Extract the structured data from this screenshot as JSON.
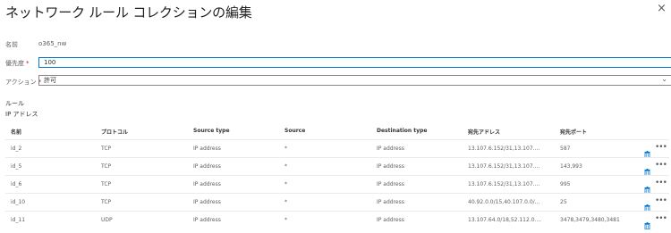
{
  "panel": {
    "title": "ネットワーク ルール コレクションの編集",
    "close": "×"
  },
  "form": {
    "name_label": "名前",
    "name_value": "o365_nw",
    "priority_label": "優先度",
    "priority_value": "100",
    "action_label": "アクション",
    "action_value": "許可",
    "required_mark": "*"
  },
  "rules": {
    "section_label": "ルール",
    "subsection_label": "IP アドレス",
    "columns": [
      "名前",
      "プロトコル",
      "Source type",
      "Source",
      "Destination type",
      "宛先アドレス",
      "宛先ポート"
    ],
    "rows": [
      [
        "id_2",
        "TCP",
        "IP address",
        "*",
        "IP address",
        "13.107.6.152/31,13.107....",
        "587"
      ],
      [
        "id_5",
        "TCP",
        "IP address",
        "*",
        "IP address",
        "13.107.6.152/31,13.107....",
        "143,993"
      ],
      [
        "id_6",
        "TCP",
        "IP address",
        "*",
        "IP address",
        "13.107.6.152/31,13.107....",
        "995"
      ],
      [
        "id_10",
        "TCP",
        "IP address",
        "*",
        "IP address",
        "40.92.0.0/15,40.107.0.0/...",
        "25"
      ],
      [
        "id_11",
        "UDP",
        "IP address",
        "*",
        "IP address",
        "13.107.64.0/18,52.112.0....",
        "3478,3479,3480,3481"
      ]
    ],
    "more_glyph": "•••"
  },
  "icons": {
    "trash": "trash-icon",
    "more": "more-options-icon",
    "chevron": "chevron-down-icon",
    "close": "close-icon"
  },
  "colors": {
    "accent": "#0078d4",
    "required": "#a4262c"
  }
}
